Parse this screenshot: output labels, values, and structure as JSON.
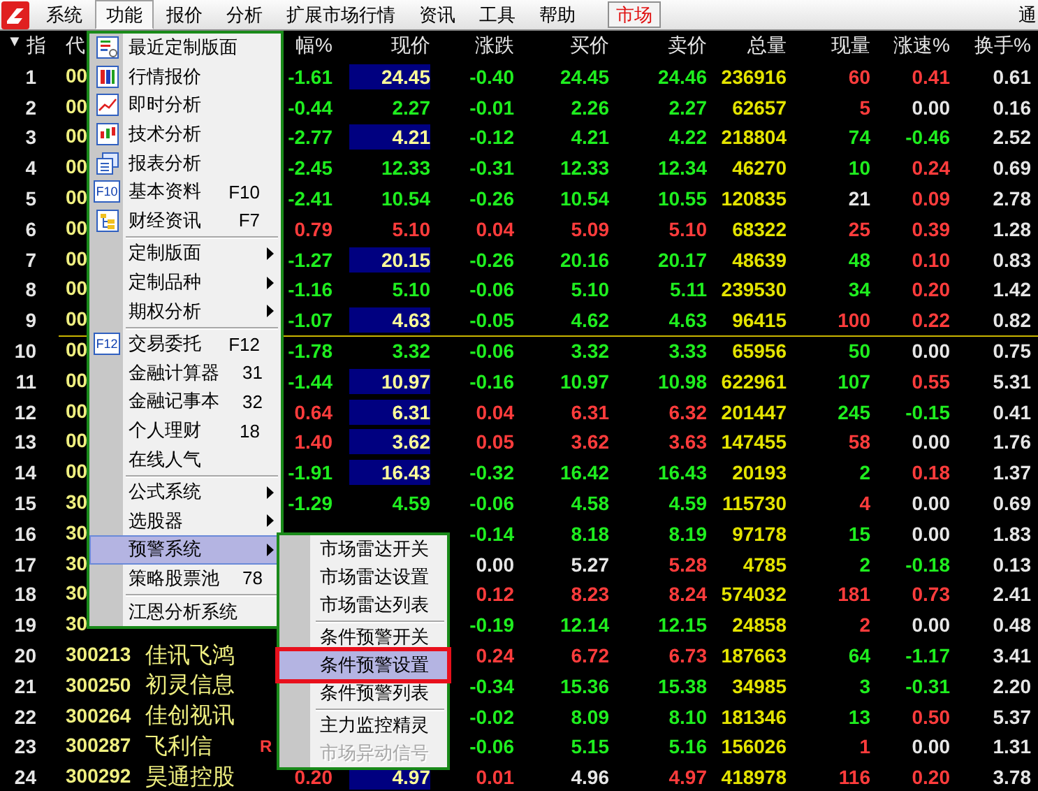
{
  "menubar": {
    "items": [
      {
        "label": "系统",
        "selected": false
      },
      {
        "label": "功能",
        "selected": true
      },
      {
        "label": "报价",
        "selected": false
      },
      {
        "label": "分析",
        "selected": false
      },
      {
        "label": "扩展市场行情",
        "selected": false
      },
      {
        "label": "资讯",
        "selected": false
      },
      {
        "label": "工具",
        "selected": false
      },
      {
        "label": "帮助",
        "selected": false
      }
    ],
    "market_button": "市场",
    "edge_item": "通"
  },
  "table": {
    "sort_mark": "▼",
    "index_label": "指",
    "code_label": "代",
    "columns": [
      "幅%",
      "现价",
      "涨跌",
      "买价",
      "卖价",
      "总量",
      "现量",
      "涨速%",
      "换手%"
    ],
    "rows": [
      {
        "index": "1",
        "code": "00",
        "cells": [
          {
            "text": "-1.61",
            "color": "#1fee1f"
          },
          {
            "text": "24.45",
            "highlighted": true
          },
          {
            "text": "-0.40",
            "color": "#1fee1f"
          },
          {
            "text": "24.45",
            "color": "#1fee1f"
          },
          {
            "text": "24.46",
            "color": "#1fee1f"
          },
          {
            "text": "236916",
            "color": "#e4e400"
          },
          {
            "text": "60",
            "color": "#ff3c3c"
          },
          {
            "text": "0.41",
            "color": "#ff3c3c"
          },
          {
            "text": "0.61",
            "color": "#e6e6e6"
          }
        ]
      },
      {
        "index": "2",
        "code": "00",
        "cells": [
          {
            "text": "-0.44",
            "color": "#1fee1f"
          },
          {
            "text": "2.27",
            "color": "#1fee1f",
            "highlighted": false
          },
          {
            "text": "-0.01",
            "color": "#1fee1f"
          },
          {
            "text": "2.26",
            "color": "#1fee1f"
          },
          {
            "text": "2.27",
            "color": "#1fee1f"
          },
          {
            "text": "62657",
            "color": "#e4e400"
          },
          {
            "text": "5",
            "color": "#ff3c3c"
          },
          {
            "text": "0.00",
            "color": "#e6e6e6"
          },
          {
            "text": "0.16",
            "color": "#e6e6e6"
          }
        ]
      },
      {
        "index": "3",
        "code": "00",
        "cells": [
          {
            "text": "-2.77",
            "color": "#1fee1f"
          },
          {
            "text": "4.21",
            "highlighted": true
          },
          {
            "text": "-0.12",
            "color": "#1fee1f"
          },
          {
            "text": "4.21",
            "color": "#1fee1f"
          },
          {
            "text": "4.22",
            "color": "#1fee1f"
          },
          {
            "text": "218804",
            "color": "#e4e400"
          },
          {
            "text": "74",
            "color": "#1fee1f"
          },
          {
            "text": "-0.46",
            "color": "#1fee1f"
          },
          {
            "text": "2.52",
            "color": "#e6e6e6"
          }
        ]
      },
      {
        "index": "4",
        "code": "00",
        "cells": [
          {
            "text": "-2.45",
            "color": "#1fee1f"
          },
          {
            "text": "12.33",
            "color": "#1fee1f",
            "highlighted": false
          },
          {
            "text": "-0.31",
            "color": "#1fee1f"
          },
          {
            "text": "12.33",
            "color": "#1fee1f"
          },
          {
            "text": "12.34",
            "color": "#1fee1f"
          },
          {
            "text": "46270",
            "color": "#e4e400"
          },
          {
            "text": "10",
            "color": "#1fee1f"
          },
          {
            "text": "0.24",
            "color": "#ff3c3c"
          },
          {
            "text": "0.69",
            "color": "#e6e6e6"
          }
        ]
      },
      {
        "index": "5",
        "code": "00",
        "cells": [
          {
            "text": "-2.41",
            "color": "#1fee1f"
          },
          {
            "text": "10.54",
            "color": "#1fee1f",
            "highlighted": false
          },
          {
            "text": "-0.26",
            "color": "#1fee1f"
          },
          {
            "text": "10.54",
            "color": "#1fee1f"
          },
          {
            "text": "10.55",
            "color": "#1fee1f"
          },
          {
            "text": "120835",
            "color": "#e4e400"
          },
          {
            "text": "21",
            "color": "#e6e6e6"
          },
          {
            "text": "0.09",
            "color": "#ff3c3c"
          },
          {
            "text": "2.78",
            "color": "#e6e6e6"
          }
        ]
      },
      {
        "index": "6",
        "code": "00",
        "cells": [
          {
            "text": "0.79",
            "color": "#ff3c3c"
          },
          {
            "text": "5.10",
            "color": "#ff3c3c",
            "highlighted": false
          },
          {
            "text": "0.04",
            "color": "#ff3c3c"
          },
          {
            "text": "5.09",
            "color": "#ff3c3c"
          },
          {
            "text": "5.10",
            "color": "#ff3c3c"
          },
          {
            "text": "68322",
            "color": "#e4e400"
          },
          {
            "text": "25",
            "color": "#ff3c3c"
          },
          {
            "text": "0.39",
            "color": "#ff3c3c"
          },
          {
            "text": "1.28",
            "color": "#e6e6e6"
          }
        ]
      },
      {
        "index": "7",
        "code": "00",
        "cells": [
          {
            "text": "-1.27",
            "color": "#1fee1f"
          },
          {
            "text": "20.15",
            "highlighted": true
          },
          {
            "text": "-0.26",
            "color": "#1fee1f"
          },
          {
            "text": "20.16",
            "color": "#1fee1f"
          },
          {
            "text": "20.17",
            "color": "#1fee1f"
          },
          {
            "text": "48639",
            "color": "#e4e400"
          },
          {
            "text": "48",
            "color": "#1fee1f"
          },
          {
            "text": "0.10",
            "color": "#ff3c3c"
          },
          {
            "text": "0.83",
            "color": "#e6e6e6"
          }
        ]
      },
      {
        "index": "8",
        "code": "00",
        "cells": [
          {
            "text": "-1.16",
            "color": "#1fee1f"
          },
          {
            "text": "5.10",
            "color": "#1fee1f",
            "highlighted": false
          },
          {
            "text": "-0.06",
            "color": "#1fee1f"
          },
          {
            "text": "5.10",
            "color": "#1fee1f"
          },
          {
            "text": "5.11",
            "color": "#1fee1f"
          },
          {
            "text": "239530",
            "color": "#e4e400"
          },
          {
            "text": "34",
            "color": "#1fee1f"
          },
          {
            "text": "0.20",
            "color": "#ff3c3c"
          },
          {
            "text": "1.42",
            "color": "#e6e6e6"
          }
        ]
      },
      {
        "index": "9",
        "code": "00",
        "cells": [
          {
            "text": "-1.07",
            "color": "#1fee1f"
          },
          {
            "text": "4.63",
            "highlighted": true
          },
          {
            "text": "-0.05",
            "color": "#1fee1f"
          },
          {
            "text": "4.62",
            "color": "#1fee1f"
          },
          {
            "text": "4.63",
            "color": "#1fee1f"
          },
          {
            "text": "96415",
            "color": "#e4e400"
          },
          {
            "text": "100",
            "color": "#ff3c3c"
          },
          {
            "text": "0.22",
            "color": "#ff3c3c"
          },
          {
            "text": "0.82",
            "color": "#e6e6e6"
          }
        ]
      },
      {
        "index": "10",
        "code": "00",
        "divider_before": true,
        "cells": [
          {
            "text": "-1.78",
            "color": "#1fee1f"
          },
          {
            "text": "3.32",
            "color": "#1fee1f",
            "highlighted": false
          },
          {
            "text": "-0.06",
            "color": "#1fee1f"
          },
          {
            "text": "3.32",
            "color": "#1fee1f"
          },
          {
            "text": "3.33",
            "color": "#1fee1f"
          },
          {
            "text": "65956",
            "color": "#e4e400"
          },
          {
            "text": "50",
            "color": "#1fee1f"
          },
          {
            "text": "0.00",
            "color": "#e6e6e6"
          },
          {
            "text": "0.75",
            "color": "#e6e6e6"
          }
        ]
      },
      {
        "index": "11",
        "code": "00",
        "cells": [
          {
            "text": "-1.44",
            "color": "#1fee1f"
          },
          {
            "text": "10.97",
            "highlighted": true
          },
          {
            "text": "-0.16",
            "color": "#1fee1f"
          },
          {
            "text": "10.97",
            "color": "#1fee1f"
          },
          {
            "text": "10.98",
            "color": "#1fee1f"
          },
          {
            "text": "622961",
            "color": "#e4e400"
          },
          {
            "text": "107",
            "color": "#1fee1f"
          },
          {
            "text": "0.55",
            "color": "#ff3c3c"
          },
          {
            "text": "5.31",
            "color": "#e6e6e6"
          }
        ]
      },
      {
        "index": "12",
        "code": "00",
        "cells": [
          {
            "text": "0.64",
            "color": "#ff3c3c"
          },
          {
            "text": "6.31",
            "highlighted": true
          },
          {
            "text": "0.04",
            "color": "#ff3c3c"
          },
          {
            "text": "6.31",
            "color": "#ff3c3c"
          },
          {
            "text": "6.32",
            "color": "#ff3c3c"
          },
          {
            "text": "201447",
            "color": "#e4e400"
          },
          {
            "text": "245",
            "color": "#1fee1f"
          },
          {
            "text": "-0.15",
            "color": "#1fee1f"
          },
          {
            "text": "0.41",
            "color": "#e6e6e6"
          }
        ]
      },
      {
        "index": "13",
        "code": "00",
        "cells": [
          {
            "text": "1.40",
            "color": "#ff3c3c"
          },
          {
            "text": "3.62",
            "highlighted": true
          },
          {
            "text": "0.05",
            "color": "#ff3c3c"
          },
          {
            "text": "3.62",
            "color": "#ff3c3c"
          },
          {
            "text": "3.63",
            "color": "#ff3c3c"
          },
          {
            "text": "147455",
            "color": "#e4e400"
          },
          {
            "text": "58",
            "color": "#ff3c3c"
          },
          {
            "text": "0.00",
            "color": "#e6e6e6"
          },
          {
            "text": "1.76",
            "color": "#e6e6e6"
          }
        ]
      },
      {
        "index": "14",
        "code": "00",
        "cells": [
          {
            "text": "-1.91",
            "color": "#1fee1f"
          },
          {
            "text": "16.43",
            "highlighted": true
          },
          {
            "text": "-0.32",
            "color": "#1fee1f"
          },
          {
            "text": "16.42",
            "color": "#1fee1f"
          },
          {
            "text": "16.43",
            "color": "#1fee1f"
          },
          {
            "text": "20193",
            "color": "#e4e400"
          },
          {
            "text": "2",
            "color": "#1fee1f"
          },
          {
            "text": "0.18",
            "color": "#ff3c3c"
          },
          {
            "text": "1.37",
            "color": "#e6e6e6"
          }
        ]
      },
      {
        "index": "15",
        "code": "30",
        "cells": [
          {
            "text": "-1.29",
            "color": "#1fee1f"
          },
          {
            "text": "4.59",
            "color": "#1fee1f",
            "highlighted": false
          },
          {
            "text": "-0.06",
            "color": "#1fee1f"
          },
          {
            "text": "4.58",
            "color": "#1fee1f"
          },
          {
            "text": "4.59",
            "color": "#1fee1f"
          },
          {
            "text": "115730",
            "color": "#e4e400"
          },
          {
            "text": "4",
            "color": "#ff3c3c"
          },
          {
            "text": "0.00",
            "color": "#e6e6e6"
          },
          {
            "text": "0.69",
            "color": "#e6e6e6"
          }
        ]
      },
      {
        "index": "16",
        "code": "30",
        "cells": [
          {
            "text": "-0.14",
            "color": "#1fee1f"
          },
          {
            "text": "8.18",
            "color": "#1fee1f"
          },
          {
            "text": "8.19",
            "color": "#1fee1f"
          },
          {
            "text": "97178",
            "color": "#e4e400"
          },
          {
            "text": "15",
            "color": "#1fee1f"
          },
          {
            "text": "0.00",
            "color": "#e6e6e6"
          },
          {
            "text": "1.83",
            "color": "#e6e6e6"
          }
        ]
      },
      {
        "index": "17",
        "code": "30",
        "cells": [
          {
            "text": "0.00",
            "color": "#e6e6e6"
          },
          {
            "text": "5.27",
            "color": "#e6e6e6"
          },
          {
            "text": "5.28",
            "color": "#ff3c3c"
          },
          {
            "text": "4785",
            "color": "#e4e400"
          },
          {
            "text": "2",
            "color": "#1fee1f"
          },
          {
            "text": "-0.18",
            "color": "#1fee1f"
          },
          {
            "text": "0.13",
            "color": "#e6e6e6"
          }
        ]
      },
      {
        "index": "18",
        "code": "30",
        "cells": [
          {
            "text": "0.12",
            "color": "#ff3c3c"
          },
          {
            "text": "8.23",
            "color": "#ff3c3c"
          },
          {
            "text": "8.24",
            "color": "#ff3c3c"
          },
          {
            "text": "574032",
            "color": "#e4e400"
          },
          {
            "text": "181",
            "color": "#ff3c3c"
          },
          {
            "text": "0.73",
            "color": "#ff3c3c"
          },
          {
            "text": "2.41",
            "color": "#e6e6e6"
          }
        ]
      },
      {
        "index": "19",
        "code": "30",
        "cells": [
          {
            "text": "-0.19",
            "color": "#1fee1f"
          },
          {
            "text": "12.14",
            "color": "#1fee1f"
          },
          {
            "text": "12.15",
            "color": "#1fee1f"
          },
          {
            "text": "24858",
            "color": "#e4e400"
          },
          {
            "text": "2",
            "color": "#ff3c3c"
          },
          {
            "text": "0.00",
            "color": "#e6e6e6"
          },
          {
            "text": "0.48",
            "color": "#e6e6e6"
          }
        ]
      },
      {
        "index": "20",
        "code": "300213",
        "name": "佳讯飞鸿",
        "cells": [
          {
            "text": "0.24",
            "color": "#ff3c3c"
          },
          {
            "text": "6.72",
            "color": "#ff3c3c"
          },
          {
            "text": "6.73",
            "color": "#ff3c3c"
          },
          {
            "text": "187663",
            "color": "#e4e400"
          },
          {
            "text": "64",
            "color": "#1fee1f"
          },
          {
            "text": "-1.17",
            "color": "#1fee1f"
          },
          {
            "text": "3.41",
            "color": "#e6e6e6"
          }
        ]
      },
      {
        "index": "21",
        "code": "300250",
        "name": "初灵信息",
        "cells": [
          {
            "text": "-0.34",
            "color": "#1fee1f"
          },
          {
            "text": "15.36",
            "color": "#1fee1f"
          },
          {
            "text": "15.38",
            "color": "#1fee1f"
          },
          {
            "text": "34985",
            "color": "#e4e400"
          },
          {
            "text": "3",
            "color": "#1fee1f"
          },
          {
            "text": "-0.31",
            "color": "#1fee1f"
          },
          {
            "text": "2.20",
            "color": "#e6e6e6"
          }
        ]
      },
      {
        "index": "22",
        "code": "300264",
        "name": "佳创视讯",
        "cells": [
          {
            "text": "-0.02",
            "color": "#1fee1f"
          },
          {
            "text": "8.09",
            "color": "#1fee1f"
          },
          {
            "text": "8.10",
            "color": "#1fee1f"
          },
          {
            "text": "181346",
            "color": "#e4e400"
          },
          {
            "text": "13",
            "color": "#1fee1f"
          },
          {
            "text": "0.50",
            "color": "#ff3c3c"
          },
          {
            "text": "5.37",
            "color": "#e6e6e6"
          }
        ]
      },
      {
        "index": "23",
        "code": "300287",
        "name": "飞利信",
        "mark": "R",
        "cells": [
          {
            "text": "-0.06",
            "color": "#1fee1f"
          },
          {
            "text": "5.15",
            "color": "#1fee1f"
          },
          {
            "text": "5.16",
            "color": "#1fee1f"
          },
          {
            "text": "156026",
            "color": "#e4e400"
          },
          {
            "text": "1",
            "color": "#ff3c3c"
          },
          {
            "text": "0.00",
            "color": "#e6e6e6"
          },
          {
            "text": "1.31",
            "color": "#e6e6e6"
          }
        ]
      },
      {
        "index": "24",
        "code": "300292",
        "name": "昊通控股",
        "cells": [
          {
            "text": "0.20",
            "color": "#ff3c3c"
          },
          {
            "text": "4.97",
            "highlighted": true
          },
          {
            "text": "0.01",
            "color": "#ff3c3c"
          },
          {
            "text": "4.96",
            "color": "#e6e6e6"
          },
          {
            "text": "4.97",
            "color": "#ff3c3c"
          },
          {
            "text": "418978",
            "color": "#e4e400"
          },
          {
            "text": "116",
            "color": "#ff3c3c"
          },
          {
            "text": "0.20",
            "color": "#ff3c3c"
          },
          {
            "text": "3.78",
            "color": "#e6e6e6"
          }
        ]
      }
    ]
  },
  "menu": {
    "items": [
      {
        "kind": "item",
        "label": "最近定制版面",
        "icon": {
          "kind": "layout"
        }
      },
      {
        "kind": "item",
        "label": "行情报价",
        "icon": {
          "kind": "grid"
        }
      },
      {
        "kind": "item",
        "label": "即时分析",
        "icon": {
          "kind": "line"
        }
      },
      {
        "kind": "item",
        "label": "技术分析",
        "icon": {
          "kind": "candle"
        }
      },
      {
        "kind": "item",
        "label": "报表分析",
        "icon": {
          "kind": "report"
        }
      },
      {
        "kind": "item",
        "label": "基本资料",
        "icon": {
          "kind": "key",
          "text": "F10"
        },
        "shortcut": "F10"
      },
      {
        "kind": "item",
        "label": "财经资讯",
        "icon": {
          "kind": "tree"
        },
        "shortcut": "F7"
      },
      {
        "kind": "separator"
      },
      {
        "kind": "item",
        "label": "定制版面",
        "submenu": true
      },
      {
        "kind": "item",
        "label": "定制品种",
        "submenu": true
      },
      {
        "kind": "item",
        "label": "期权分析",
        "submenu": true
      },
      {
        "kind": "separator"
      },
      {
        "kind": "item",
        "label": "交易委托",
        "icon": {
          "kind": "key",
          "text": "F12"
        },
        "shortcut": "F12"
      },
      {
        "kind": "item",
        "label": "金融计算器",
        "shortcut": "31"
      },
      {
        "kind": "item",
        "label": "金融记事本",
        "shortcut": "32"
      },
      {
        "kind": "item",
        "label": "个人理财",
        "shortcut": "18"
      },
      {
        "kind": "item",
        "label": "在线人气"
      },
      {
        "kind": "separator"
      },
      {
        "kind": "item",
        "label": "公式系统",
        "submenu": true
      },
      {
        "kind": "item",
        "label": "选股器",
        "submenu": true
      },
      {
        "kind": "item",
        "label": "预警系统",
        "submenu": true,
        "selected": true
      },
      {
        "kind": "item",
        "label": "策略股票池",
        "shortcut": "78"
      },
      {
        "kind": "separator"
      },
      {
        "kind": "item",
        "label": "江恩分析系统"
      }
    ]
  },
  "submenu": {
    "items": [
      {
        "kind": "item",
        "label": "市场雷达开关"
      },
      {
        "kind": "item",
        "label": "市场雷达设置"
      },
      {
        "kind": "item",
        "label": "市场雷达列表"
      },
      {
        "kind": "separator"
      },
      {
        "kind": "item",
        "label": "条件预警开关"
      },
      {
        "kind": "item",
        "label": "条件预警设置",
        "selected": true,
        "annotated": true
      },
      {
        "kind": "item",
        "label": "条件预警列表"
      },
      {
        "kind": "separator"
      },
      {
        "kind": "item",
        "label": "主力监控精灵"
      },
      {
        "kind": "item",
        "label": "市场异动信号",
        "disabled": true
      }
    ]
  }
}
